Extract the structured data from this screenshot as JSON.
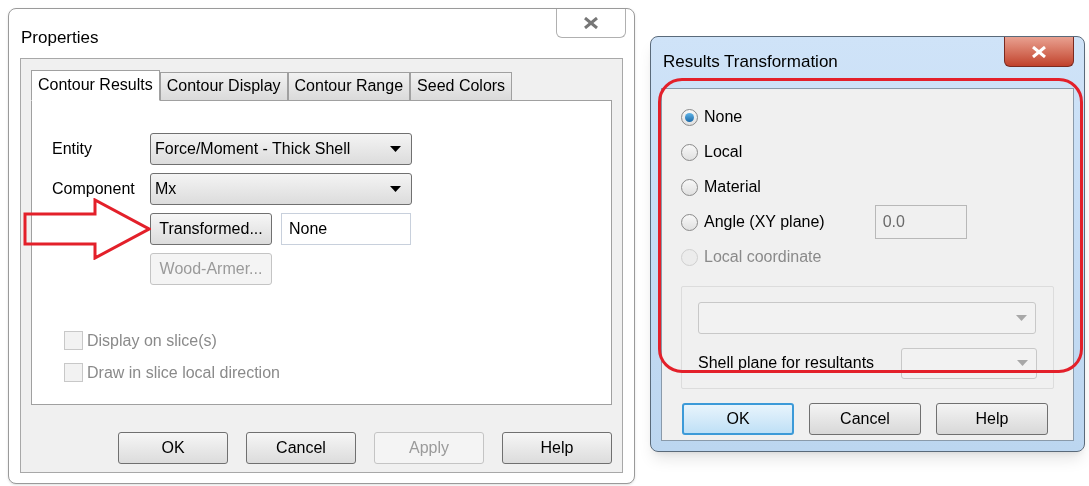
{
  "properties": {
    "title": "Properties",
    "tabs": [
      {
        "label": "Contour Results",
        "selected": true
      },
      {
        "label": "Contour Display",
        "selected": false
      },
      {
        "label": "Contour Range",
        "selected": false
      },
      {
        "label": "Seed Colors",
        "selected": false
      }
    ],
    "fields": [
      {
        "label": "Entity",
        "value": "Force/Moment - Thick Shell"
      },
      {
        "label": "Component",
        "value": "Mx"
      }
    ],
    "transformed_button": {
      "label": "Transformed...",
      "disabled": false
    },
    "transform_value": "None",
    "wood_armer_button": {
      "label": "Wood-Armer...",
      "disabled": true
    },
    "checkboxes": [
      {
        "label": "Display on slice(s)",
        "checked": false,
        "disabled": true
      },
      {
        "label": "Draw in slice local direction",
        "checked": false,
        "disabled": true
      }
    ],
    "buttons": [
      {
        "label": "OK",
        "disabled": false
      },
      {
        "label": "Cancel",
        "disabled": false
      },
      {
        "label": "Apply",
        "disabled": true
      },
      {
        "label": "Help",
        "disabled": false
      }
    ]
  },
  "results_transformation": {
    "title": "Results Transformation",
    "options": [
      {
        "label": "None",
        "selected": true,
        "disabled": false
      },
      {
        "label": "Local",
        "selected": false,
        "disabled": false
      },
      {
        "label": "Material",
        "selected": false,
        "disabled": false
      },
      {
        "label": "Angle (XY plane)",
        "selected": false,
        "disabled": false
      },
      {
        "label": "Local coordinate",
        "selected": false,
        "disabled": true
      }
    ],
    "angle_value": "0.0",
    "shell_plane_label": "Shell plane for resultants",
    "buttons": [
      {
        "label": "OK",
        "default": true
      },
      {
        "label": "Cancel",
        "default": false
      },
      {
        "label": "Help",
        "default": false
      }
    ]
  }
}
